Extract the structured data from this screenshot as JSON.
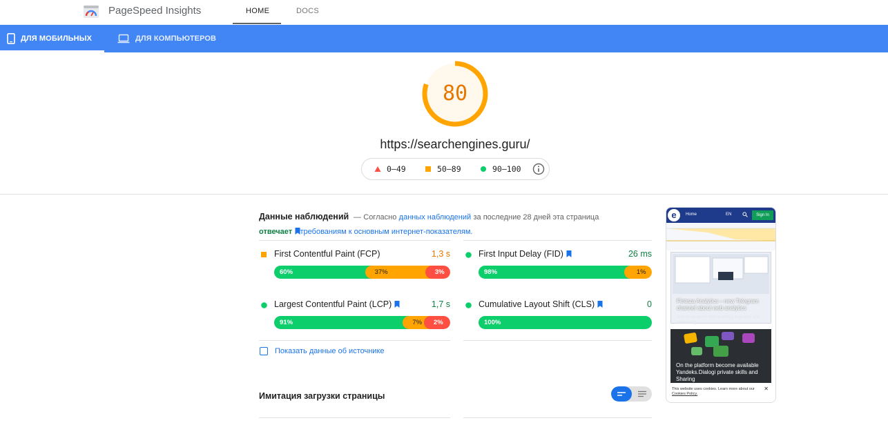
{
  "header": {
    "app_title": "PageSpeed Insights",
    "tabs": [
      {
        "label": "HOME"
      },
      {
        "label": "DOCS"
      }
    ]
  },
  "device_tabs": [
    {
      "label": "ДЛЯ МОБИЛЬНЫХ",
      "icon": "smartphone-icon",
      "active": true
    },
    {
      "label": "ДЛЯ КОМПЬЮТЕРОВ",
      "icon": "laptop-icon",
      "active": false
    }
  ],
  "score": {
    "value": "80",
    "fraction": 0.8,
    "color": "#ffa400",
    "url": "https://searchengines.guru/"
  },
  "legend": [
    {
      "range": "0–49",
      "shape": "triangle",
      "color": "#ff4e42"
    },
    {
      "range": "50–89",
      "shape": "square",
      "color": "#ffa400"
    },
    {
      "range": "90–100",
      "shape": "circle",
      "color": "#0cce6b"
    }
  ],
  "field_data": {
    "title": "Данные наблюдений",
    "dash": "—",
    "text_prefix": "Согласно",
    "link_text": "данных наблюдений",
    "text_middle": "за последние 28 дней эта страница",
    "status": "отвечает",
    "requirement_link": "требованиям к основным интернет-показателям."
  },
  "metrics": [
    {
      "name": "First Contentful Paint (FCP)",
      "value": "1,3 s",
      "status_color": "#e67700",
      "marker": "square",
      "bookmark": false,
      "segments": [
        {
          "label": "60%",
          "pct": 60,
          "kind": "g"
        },
        {
          "label": "37%",
          "pct": 37,
          "kind": "o"
        },
        {
          "label": "3%",
          "pct": 3,
          "kind": "r"
        }
      ]
    },
    {
      "name": "First Input Delay (FID)",
      "value": "26 ms",
      "status_color": "#0d8043",
      "marker": "circle",
      "bookmark": true,
      "segments": [
        {
          "label": "98%",
          "pct": 98,
          "kind": "g"
        },
        {
          "label": "1%",
          "pct": 1,
          "kind": "o"
        }
      ]
    },
    {
      "name": "Largest Contentful Paint (LCP)",
      "value": "1,7 s",
      "status_color": "#0d8043",
      "marker": "circle",
      "bookmark": true,
      "segments": [
        {
          "label": "91%",
          "pct": 91,
          "kind": "g"
        },
        {
          "label": "7%",
          "pct": 7,
          "kind": "o"
        },
        {
          "label": "2%",
          "pct": 2,
          "kind": "r"
        }
      ]
    },
    {
      "name": "Cumulative Layout Shift (CLS)",
      "value": "0",
      "status_color": "#0d8043",
      "marker": "circle",
      "bookmark": true,
      "segments": [
        {
          "label": "100%",
          "pct": 100,
          "kind": "g"
        }
      ]
    }
  ],
  "origin_toggle": {
    "label": "Показать данные об источнике",
    "checked": false
  },
  "lab_data": {
    "title": "Имитация загрузки страницы"
  },
  "thumbnail": {
    "logo_letter": "e",
    "nav_home": "Home",
    "nav_lang": "EN",
    "sign_in": "Sign In",
    "card1_title": "Finteza Analytics – new Telegram channel about web analytics",
    "card1_sub": "Join so as not to miss anything important and interesting",
    "card2_title": "On the platform become available Yandeks.Dialogi private skills and Sharing",
    "cookie_text": "This website uses cookies. Learn more about our",
    "cookie_link": "Cookies Policy."
  }
}
